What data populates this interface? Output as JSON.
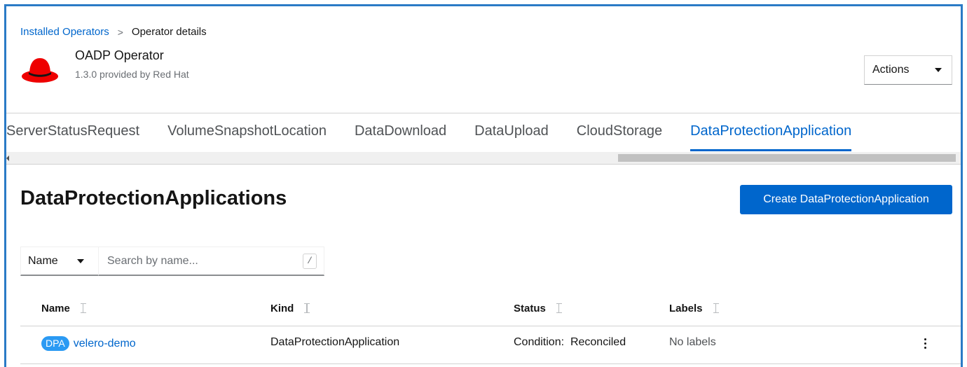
{
  "breadcrumb": {
    "parent": "Installed Operators",
    "separator": ">",
    "current": "Operator details"
  },
  "operator": {
    "name": "OADP Operator",
    "version_provider": "1.3.0 provided by Red Hat",
    "logo_icon": "redhat-fedora-icon",
    "logo_color": "#ee0000"
  },
  "actions": {
    "label": "Actions"
  },
  "tabs": [
    {
      "label": "ServerStatusRequest",
      "active": false
    },
    {
      "label": "VolumeSnapshotLocation",
      "active": false
    },
    {
      "label": "DataDownload",
      "active": false
    },
    {
      "label": "DataUpload",
      "active": false
    },
    {
      "label": "CloudStorage",
      "active": false
    },
    {
      "label": "DataProtectionApplication",
      "active": true
    }
  ],
  "main": {
    "title": "DataProtectionApplications",
    "create_button": "Create DataProtectionApplication"
  },
  "filter": {
    "type_label": "Name",
    "search_placeholder": "Search by name...",
    "shortcut": "/"
  },
  "table": {
    "columns": [
      "Name",
      "Kind",
      "Status",
      "Labels"
    ],
    "rows": [
      {
        "badge": "DPA",
        "name": "velero-demo",
        "kind": "DataProtectionApplication",
        "status": "Condition:  Reconciled",
        "labels": "No labels"
      }
    ]
  },
  "colors": {
    "accent": "#0066cc",
    "badge": "#2b9af3",
    "frame": "#2b7bc6"
  }
}
